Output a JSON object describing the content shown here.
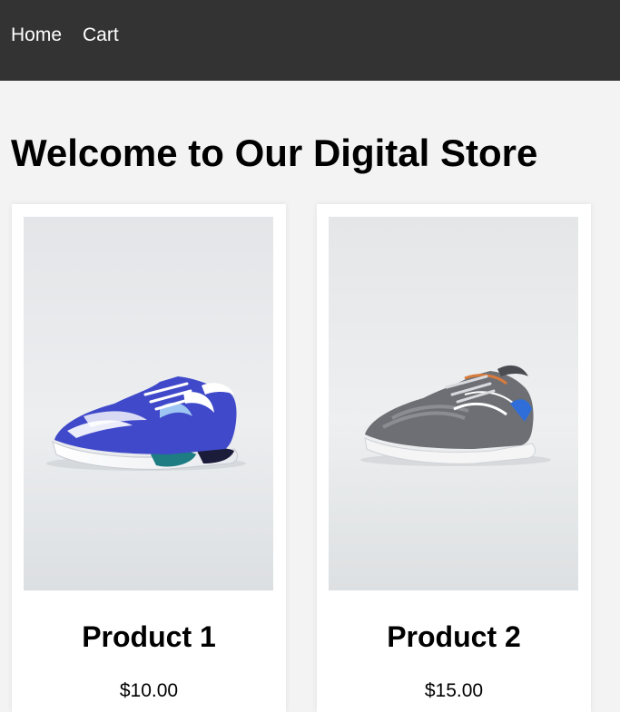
{
  "nav": {
    "home_label": "Home",
    "cart_label": "Cart"
  },
  "page": {
    "title": "Welcome to Our Digital Store"
  },
  "products": [
    {
      "name": "Product 1",
      "price": "$10.00",
      "image": "blue-white-running-shoe"
    },
    {
      "name": "Product 2",
      "price": "$15.00",
      "image": "grey-running-shoe"
    }
  ],
  "colors": {
    "navbar_bg": "#333333",
    "page_bg": "#f3f3f3",
    "card_bg": "#ffffff",
    "nav_text": "#ffffff"
  }
}
